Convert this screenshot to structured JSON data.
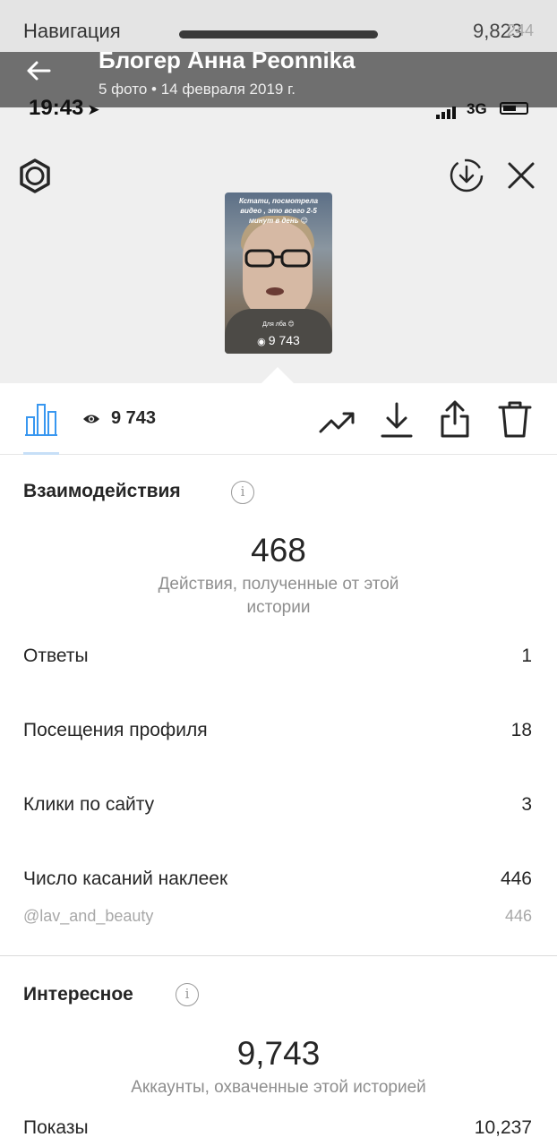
{
  "underlay": {
    "nav_title": "Навигация",
    "count_main": "9,823",
    "count_faint": "244",
    "time": "19:43",
    "network": "3G"
  },
  "gallery": {
    "title": "Блогер Анна Peonnika",
    "subtitle": "5 фото  •  14 февраля 2019 г."
  },
  "story_thumb": {
    "caption": "Кстати, посмотрела видео , это всего 2-5 минут в день 😉",
    "subtitle": "Для лба 😊",
    "views": "9 743"
  },
  "toolbar": {
    "views_count": "9 743"
  },
  "interactions": {
    "title": "Взаимодействия",
    "total": "468",
    "caption": "Действия, полученные от этой истории",
    "rows": [
      {
        "label": "Ответы",
        "value": "1"
      },
      {
        "label": "Посещения профиля",
        "value": "18"
      },
      {
        "label": "Клики по сайту",
        "value": "3"
      },
      {
        "label": "Число касаний наклеек",
        "value": "446"
      }
    ],
    "sticker": {
      "label": "@lav_and_beauty",
      "value": "446"
    }
  },
  "discovery": {
    "title": "Интересное",
    "total": "9,743",
    "caption": "Аккаунты, охваченные этой историей",
    "rows": [
      {
        "label": "Показы",
        "value": "10,237"
      }
    ]
  },
  "colors": {
    "accent_blue": "#3897f0",
    "text_primary": "#262626",
    "text_secondary": "#8e8e8e"
  }
}
